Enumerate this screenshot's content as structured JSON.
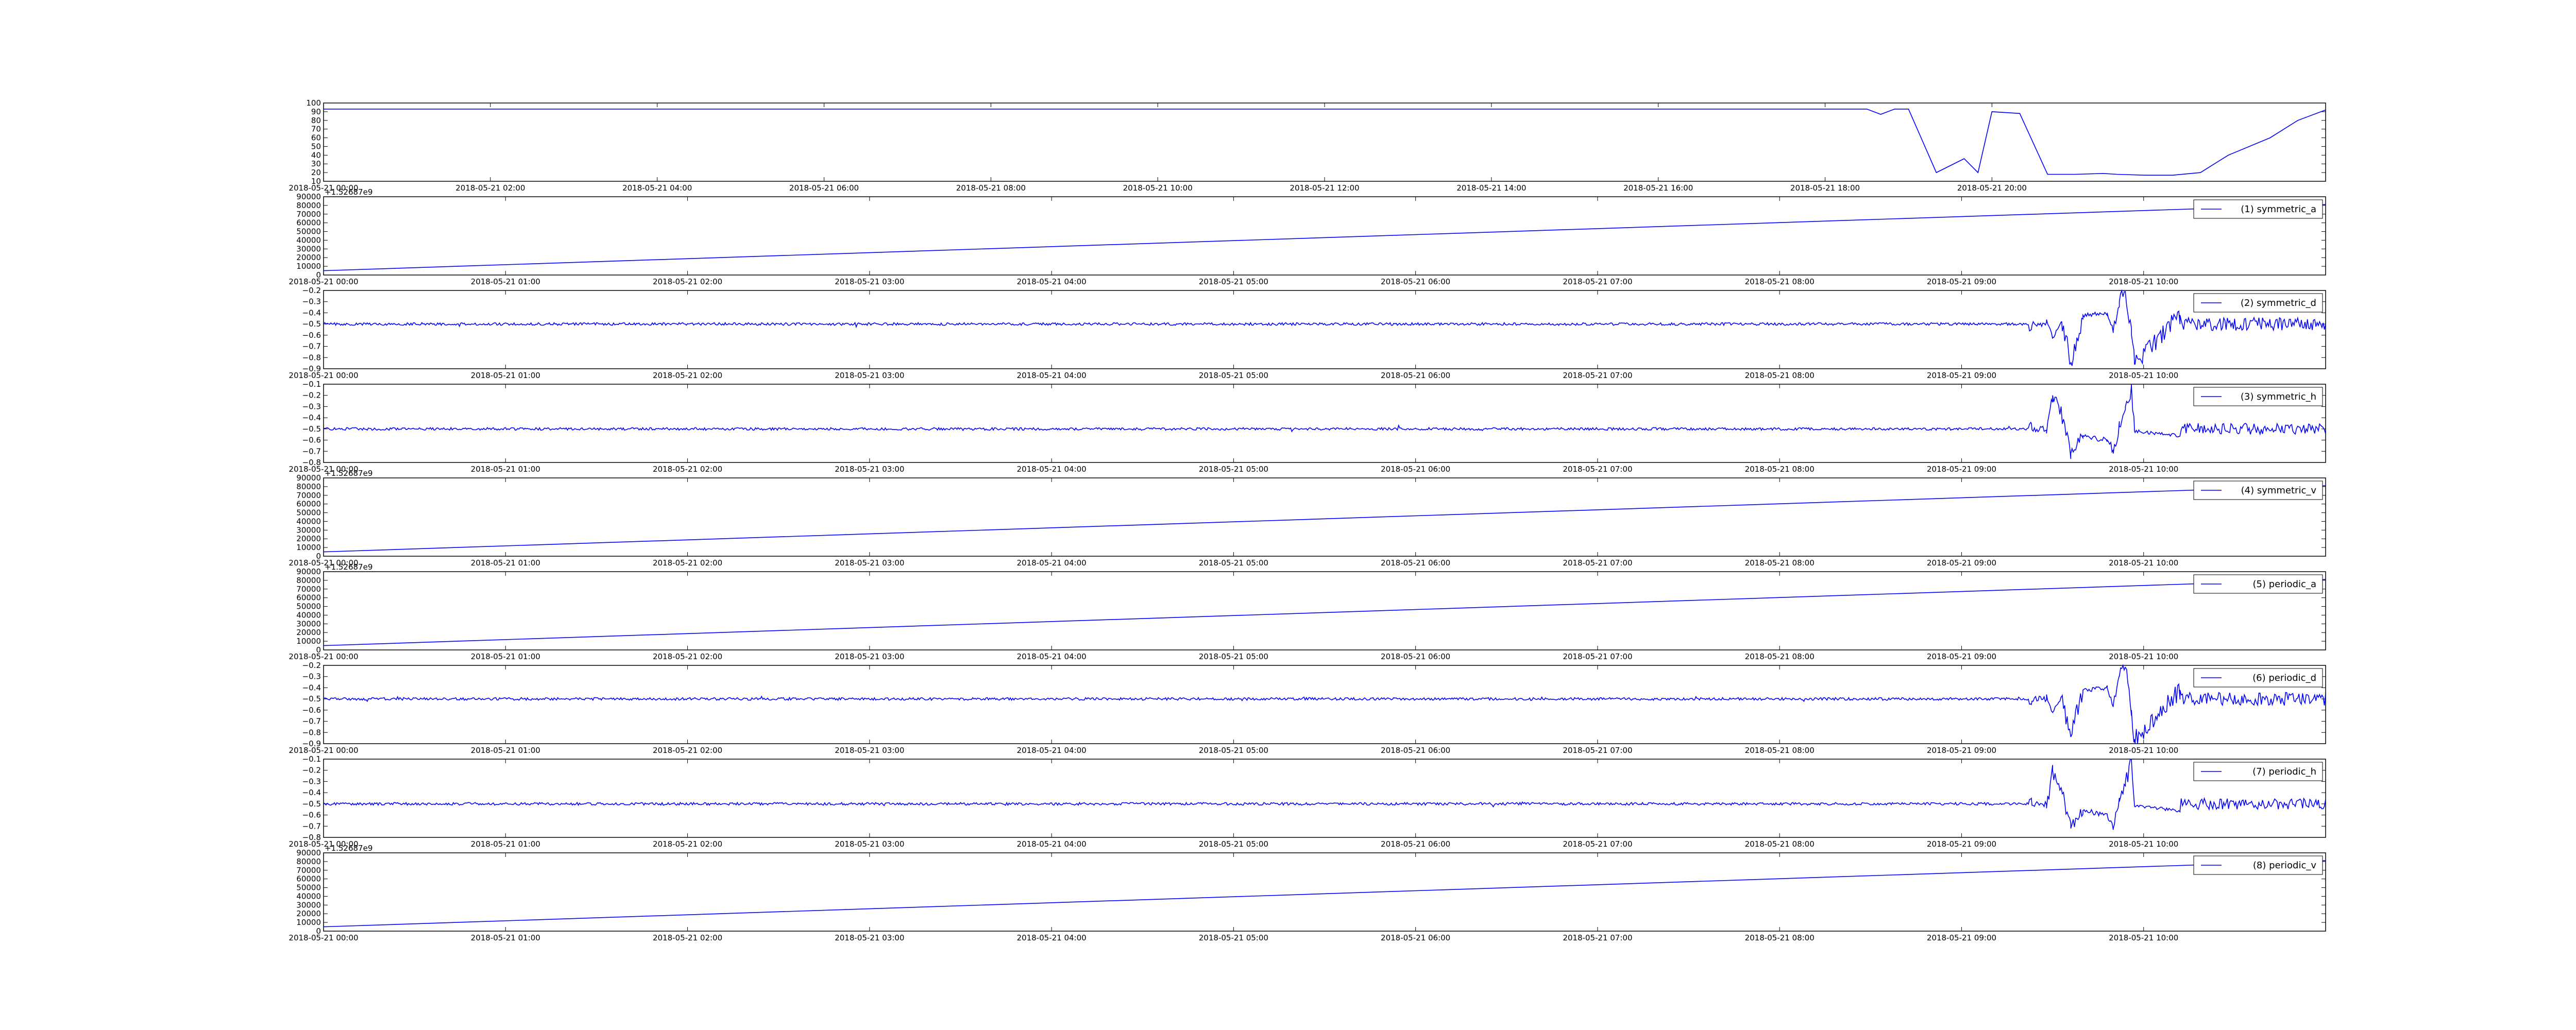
{
  "colors": {
    "line": "#0000ff",
    "axes": "#000000",
    "background": "#ffffff"
  },
  "chart_data": [
    {
      "id": "p0",
      "type": "line",
      "title": "",
      "xlabel": "",
      "ylabel": "",
      "xlim": [
        "2018-05-21 00:00",
        "2018-05-22 00:00"
      ],
      "ylim": [
        10,
        100
      ],
      "yticks": [
        10,
        20,
        30,
        40,
        50,
        60,
        70,
        80,
        90,
        100
      ],
      "yticklabels": [
        "10",
        "20",
        "30",
        "40",
        "50",
        "60",
        "70",
        "80",
        "90",
        "100"
      ],
      "xticks": [
        "2018-05-21 00:00",
        "2018-05-21 02:00",
        "2018-05-21 04:00",
        "2018-05-21 06:00",
        "2018-05-21 08:00",
        "2018-05-21 10:00",
        "2018-05-21 12:00",
        "2018-05-21 14:00",
        "2018-05-21 16:00",
        "2018-05-21 18:00",
        "2018-05-21 20:00"
      ],
      "offset_text": "",
      "legend": null,
      "series": [
        {
          "values_x": [
            "2018-05-21 00:00",
            "2018-05-21 18:30",
            "2018-05-21 18:40",
            "2018-05-21 18:50",
            "2018-05-21 19:00",
            "2018-05-21 19:20",
            "2018-05-21 19:40",
            "2018-05-21 19:50",
            "2018-05-21 20:00",
            "2018-05-21 20:20",
            "2018-05-21 20:40",
            "2018-05-21 21:00",
            "2018-05-21 21:20",
            "2018-05-21 21:30",
            "2018-05-21 21:50",
            "2018-05-21 22:10",
            "2018-05-21 22:30",
            "2018-05-21 22:50",
            "2018-05-21 23:20",
            "2018-05-21 23:40",
            "2018-05-22 00:00"
          ],
          "values_y": [
            93,
            93,
            87,
            93,
            93,
            20,
            36,
            20,
            90,
            88,
            18,
            18,
            19,
            18,
            17,
            17,
            20,
            40,
            60,
            80,
            92
          ]
        }
      ]
    },
    {
      "id": "p1",
      "type": "line",
      "title": "",
      "xlabel": "",
      "ylabel": "",
      "xlim": [
        "2018-05-21 00:00",
        "2018-05-21 11:00"
      ],
      "ylim": [
        0,
        90000
      ],
      "yticks": [
        0,
        10000,
        20000,
        30000,
        40000,
        50000,
        60000,
        70000,
        80000,
        90000
      ],
      "yticklabels": [
        "0",
        "10000",
        "20000",
        "30000",
        "40000",
        "50000",
        "60000",
        "70000",
        "80000",
        "90000"
      ],
      "xticks": [
        "2018-05-21 00:00",
        "2018-05-21 01:00",
        "2018-05-21 02:00",
        "2018-05-21 03:00",
        "2018-05-21 04:00",
        "2018-05-21 05:00",
        "2018-05-21 06:00",
        "2018-05-21 07:00",
        "2018-05-21 08:00",
        "2018-05-21 09:00",
        "2018-05-21 10:00"
      ],
      "offset_text": "+1.52687e9",
      "legend": "(1) symmetric_a",
      "series": [
        {
          "values_x": [
            "2018-05-21 00:00",
            "2018-05-21 11:00"
          ],
          "values_y": [
            5000,
            81000
          ]
        }
      ]
    },
    {
      "id": "p2",
      "type": "line",
      "title": "",
      "xlabel": "",
      "ylabel": "",
      "xlim": [
        "2018-05-21 00:00",
        "2018-05-21 11:00"
      ],
      "ylim": [
        -0.9,
        -0.2
      ],
      "yticks": [
        -0.9,
        -0.8,
        -0.7,
        -0.6,
        -0.5,
        -0.4,
        -0.3,
        -0.2
      ],
      "yticklabels": [
        "−0.9",
        "−0.8",
        "−0.7",
        "−0.6",
        "−0.5",
        "−0.4",
        "−0.3",
        "−0.2"
      ],
      "xticks": [
        "2018-05-21 00:00",
        "2018-05-21 01:00",
        "2018-05-21 02:00",
        "2018-05-21 03:00",
        "2018-05-21 04:00",
        "2018-05-21 05:00",
        "2018-05-21 06:00",
        "2018-05-21 07:00",
        "2018-05-21 08:00",
        "2018-05-21 09:00",
        "2018-05-21 10:00"
      ],
      "offset_text": "",
      "legend": "(2) symmetric_d",
      "series": [
        {
          "baseline": -0.5,
          "noise": 0.012,
          "events_x": [
            "2018-05-21 09:23",
            "2018-05-21 09:28",
            "2018-05-21 09:30",
            "2018-05-21 09:33",
            "2018-05-21 09:36",
            "2018-05-21 09:40",
            "2018-05-21 09:48",
            "2018-05-21 09:50",
            "2018-05-21 09:52",
            "2018-05-21 09:54",
            "2018-05-21 09:56",
            "2018-05-21 09:57",
            "2018-05-21 10:12"
          ],
          "events_y": [
            -0.55,
            -0.46,
            -0.62,
            -0.48,
            -0.84,
            -0.42,
            -0.4,
            -0.56,
            -0.3,
            -0.22,
            -0.6,
            -0.86,
            -0.42
          ],
          "dense_range_x": [
            "2018-05-21 10:12",
            "2018-05-21 11:00"
          ],
          "dense_amplitude": 0.06
        }
      ]
    },
    {
      "id": "p3",
      "type": "line",
      "title": "",
      "xlabel": "",
      "ylabel": "",
      "xlim": [
        "2018-05-21 00:00",
        "2018-05-21 11:00"
      ],
      "ylim": [
        -0.8,
        -0.1
      ],
      "yticks": [
        -0.8,
        -0.7,
        -0.6,
        -0.5,
        -0.4,
        -0.3,
        -0.2,
        -0.1
      ],
      "yticklabels": [
        "−0.8",
        "−0.7",
        "−0.6",
        "−0.5",
        "−0.4",
        "−0.3",
        "−0.2",
        "−0.1"
      ],
      "xticks": [
        "2018-05-21 00:00",
        "2018-05-21 01:00",
        "2018-05-21 02:00",
        "2018-05-21 03:00",
        "2018-05-21 04:00",
        "2018-05-21 05:00",
        "2018-05-21 06:00",
        "2018-05-21 07:00",
        "2018-05-21 08:00",
        "2018-05-21 09:00",
        "2018-05-21 10:00"
      ],
      "offset_text": "",
      "legend": "(3) symmetric_h",
      "series": [
        {
          "baseline": -0.5,
          "noise": 0.012,
          "events_x": [
            "2018-05-21 09:23",
            "2018-05-21 09:28",
            "2018-05-21 09:30",
            "2018-05-21 09:33",
            "2018-05-21 09:36",
            "2018-05-21 09:40",
            "2018-05-21 09:48",
            "2018-05-21 09:50",
            "2018-05-21 09:52",
            "2018-05-21 09:54",
            "2018-05-21 09:56",
            "2018-05-21 09:57",
            "2018-05-21 10:12"
          ],
          "events_y": [
            -0.45,
            -0.54,
            -0.2,
            -0.38,
            -0.72,
            -0.56,
            -0.6,
            -0.72,
            -0.48,
            -0.3,
            -0.12,
            -0.52,
            -0.56
          ],
          "dense_range_x": [
            "2018-05-21 10:12",
            "2018-05-21 11:00"
          ],
          "dense_amplitude": 0.05
        }
      ]
    },
    {
      "id": "p4",
      "type": "line",
      "title": "",
      "xlabel": "",
      "ylabel": "",
      "xlim": [
        "2018-05-21 00:00",
        "2018-05-21 11:00"
      ],
      "ylim": [
        0,
        90000
      ],
      "yticks": [
        0,
        10000,
        20000,
        30000,
        40000,
        50000,
        60000,
        70000,
        80000,
        90000
      ],
      "yticklabels": [
        "0",
        "10000",
        "20000",
        "30000",
        "40000",
        "50000",
        "60000",
        "70000",
        "80000",
        "90000"
      ],
      "xticks": [
        "2018-05-21 00:00",
        "2018-05-21 01:00",
        "2018-05-21 02:00",
        "2018-05-21 03:00",
        "2018-05-21 04:00",
        "2018-05-21 05:00",
        "2018-05-21 06:00",
        "2018-05-21 07:00",
        "2018-05-21 08:00",
        "2018-05-21 09:00",
        "2018-05-21 10:00"
      ],
      "offset_text": "+1.52687e9",
      "legend": "(4) symmetric_v",
      "series": [
        {
          "values_x": [
            "2018-05-21 00:00",
            "2018-05-21 11:00"
          ],
          "values_y": [
            5000,
            81000
          ]
        }
      ]
    },
    {
      "id": "p5",
      "type": "line",
      "title": "",
      "xlabel": "",
      "ylabel": "",
      "xlim": [
        "2018-05-21 00:00",
        "2018-05-21 11:00"
      ],
      "ylim": [
        0,
        90000
      ],
      "yticks": [
        0,
        10000,
        20000,
        30000,
        40000,
        50000,
        60000,
        70000,
        80000,
        90000
      ],
      "yticklabels": [
        "0",
        "10000",
        "20000",
        "30000",
        "40000",
        "50000",
        "60000",
        "70000",
        "80000",
        "90000"
      ],
      "xticks": [
        "2018-05-21 00:00",
        "2018-05-21 01:00",
        "2018-05-21 02:00",
        "2018-05-21 03:00",
        "2018-05-21 04:00",
        "2018-05-21 05:00",
        "2018-05-21 06:00",
        "2018-05-21 07:00",
        "2018-05-21 08:00",
        "2018-05-21 09:00",
        "2018-05-21 10:00"
      ],
      "offset_text": "+1.52687e9",
      "legend": "(5) periodic_a",
      "series": [
        {
          "values_x": [
            "2018-05-21 00:00",
            "2018-05-21 11:00"
          ],
          "values_y": [
            5000,
            81000
          ]
        }
      ]
    },
    {
      "id": "p6",
      "type": "line",
      "title": "",
      "xlabel": "",
      "ylabel": "",
      "xlim": [
        "2018-05-21 00:00",
        "2018-05-21 11:00"
      ],
      "ylim": [
        -0.9,
        -0.2
      ],
      "yticks": [
        -0.9,
        -0.8,
        -0.7,
        -0.6,
        -0.5,
        -0.4,
        -0.3,
        -0.2
      ],
      "yticklabels": [
        "−0.9",
        "−0.8",
        "−0.7",
        "−0.6",
        "−0.5",
        "−0.4",
        "−0.3",
        "−0.2"
      ],
      "xticks": [
        "2018-05-21 00:00",
        "2018-05-21 01:00",
        "2018-05-21 02:00",
        "2018-05-21 03:00",
        "2018-05-21 04:00",
        "2018-05-21 05:00",
        "2018-05-21 06:00",
        "2018-05-21 07:00",
        "2018-05-21 08:00",
        "2018-05-21 09:00",
        "2018-05-21 10:00"
      ],
      "offset_text": "",
      "legend": "(6) periodic_d",
      "series": [
        {
          "baseline": -0.5,
          "noise": 0.012,
          "events_x": [
            "2018-05-21 09:23",
            "2018-05-21 09:28",
            "2018-05-21 09:30",
            "2018-05-21 09:33",
            "2018-05-21 09:36",
            "2018-05-21 09:40",
            "2018-05-21 09:48",
            "2018-05-21 09:50",
            "2018-05-21 09:52",
            "2018-05-21 09:54",
            "2018-05-21 09:56",
            "2018-05-21 09:57",
            "2018-05-21 10:12"
          ],
          "events_y": [
            -0.55,
            -0.46,
            -0.62,
            -0.48,
            -0.84,
            -0.42,
            -0.4,
            -0.56,
            -0.3,
            -0.22,
            -0.6,
            -0.86,
            -0.42
          ],
          "dense_range_x": [
            "2018-05-21 10:12",
            "2018-05-21 11:00"
          ],
          "dense_amplitude": 0.06
        }
      ]
    },
    {
      "id": "p7",
      "type": "line",
      "title": "",
      "xlabel": "",
      "ylabel": "",
      "xlim": [
        "2018-05-21 00:00",
        "2018-05-21 11:00"
      ],
      "ylim": [
        -0.8,
        -0.1
      ],
      "yticks": [
        -0.8,
        -0.7,
        -0.6,
        -0.5,
        -0.4,
        -0.3,
        -0.2,
        -0.1
      ],
      "yticklabels": [
        "−0.8",
        "−0.7",
        "−0.6",
        "−0.5",
        "−0.4",
        "−0.3",
        "−0.2",
        "−0.1"
      ],
      "xticks": [
        "2018-05-21 00:00",
        "2018-05-21 01:00",
        "2018-05-21 02:00",
        "2018-05-21 03:00",
        "2018-05-21 04:00",
        "2018-05-21 05:00",
        "2018-05-21 06:00",
        "2018-05-21 07:00",
        "2018-05-21 08:00",
        "2018-05-21 09:00",
        "2018-05-21 10:00"
      ],
      "offset_text": "",
      "legend": "(7) periodic_h",
      "series": [
        {
          "baseline": -0.5,
          "noise": 0.012,
          "events_x": [
            "2018-05-21 09:23",
            "2018-05-21 09:28",
            "2018-05-21 09:30",
            "2018-05-21 09:33",
            "2018-05-21 09:36",
            "2018-05-21 09:40",
            "2018-05-21 09:48",
            "2018-05-21 09:50",
            "2018-05-21 09:52",
            "2018-05-21 09:54",
            "2018-05-21 09:56",
            "2018-05-21 09:57",
            "2018-05-21 10:12"
          ],
          "events_y": [
            -0.45,
            -0.54,
            -0.2,
            -0.38,
            -0.72,
            -0.56,
            -0.6,
            -0.72,
            -0.48,
            -0.3,
            -0.12,
            -0.52,
            -0.56
          ],
          "dense_range_x": [
            "2018-05-21 10:12",
            "2018-05-21 11:00"
          ],
          "dense_amplitude": 0.05
        }
      ]
    },
    {
      "id": "p8",
      "type": "line",
      "title": "",
      "xlabel": "",
      "ylabel": "",
      "xlim": [
        "2018-05-21 00:00",
        "2018-05-21 11:00"
      ],
      "ylim": [
        0,
        90000
      ],
      "yticks": [
        0,
        10000,
        20000,
        30000,
        40000,
        50000,
        60000,
        70000,
        80000,
        90000
      ],
      "yticklabels": [
        "0",
        "10000",
        "20000",
        "30000",
        "40000",
        "50000",
        "60000",
        "70000",
        "80000",
        "90000"
      ],
      "xticks": [
        "2018-05-21 00:00",
        "2018-05-21 01:00",
        "2018-05-21 02:00",
        "2018-05-21 03:00",
        "2018-05-21 04:00",
        "2018-05-21 05:00",
        "2018-05-21 06:00",
        "2018-05-21 07:00",
        "2018-05-21 08:00",
        "2018-05-21 09:00",
        "2018-05-21 10:00"
      ],
      "offset_text": "+1.52687e9",
      "legend": "(8) periodic_v",
      "series": [
        {
          "values_x": [
            "2018-05-21 00:00",
            "2018-05-21 11:00"
          ],
          "values_y": [
            5000,
            81000
          ]
        }
      ]
    }
  ]
}
